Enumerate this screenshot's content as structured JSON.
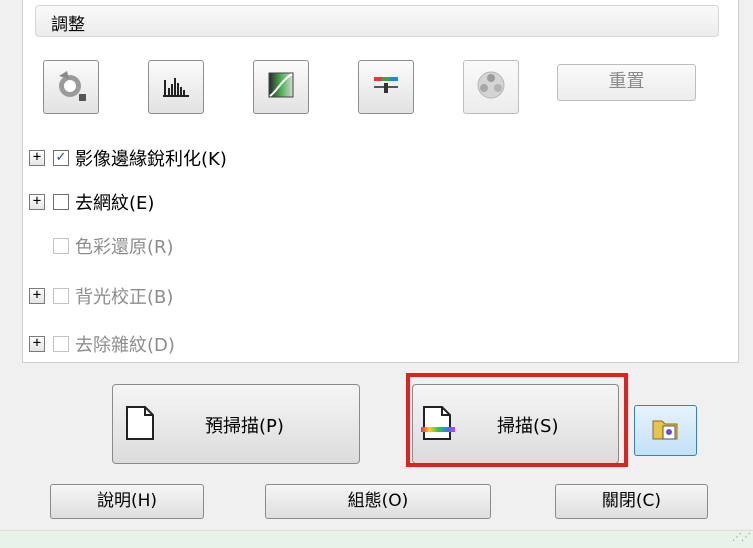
{
  "adjustments": {
    "title": "調整",
    "tools": [
      {
        "icon": "auto-exposure-icon",
        "enabled": true
      },
      {
        "icon": "histogram-icon",
        "enabled": true
      },
      {
        "icon": "tone-curve-icon",
        "enabled": true
      },
      {
        "icon": "color-balance-icon",
        "enabled": true
      },
      {
        "icon": "color-palette-icon",
        "enabled": false
      }
    ],
    "reset_label": "重置"
  },
  "options": [
    {
      "label": "影像邊緣銳利化(K)",
      "checked": true,
      "enabled": true,
      "expandable": true
    },
    {
      "label": "去網紋(E)",
      "checked": false,
      "enabled": true,
      "expandable": true
    },
    {
      "label": "色彩還原(R)",
      "checked": false,
      "enabled": false,
      "expandable": false
    },
    {
      "label": "背光校正(B)",
      "checked": false,
      "enabled": false,
      "expandable": true
    },
    {
      "label": "去除雜紋(D)",
      "checked": false,
      "enabled": false,
      "expandable": true
    }
  ],
  "actions": {
    "preview_label": "預掃描(P)",
    "scan_label": "掃描(S)",
    "file_save_icon": "file-save-settings-icon"
  },
  "footer": {
    "help_label": "說明(H)",
    "config_label": "組態(O)",
    "close_label": "關閉(C)"
  },
  "colors": {
    "highlight": "#e2211c",
    "accent": "#3c7fb1"
  }
}
